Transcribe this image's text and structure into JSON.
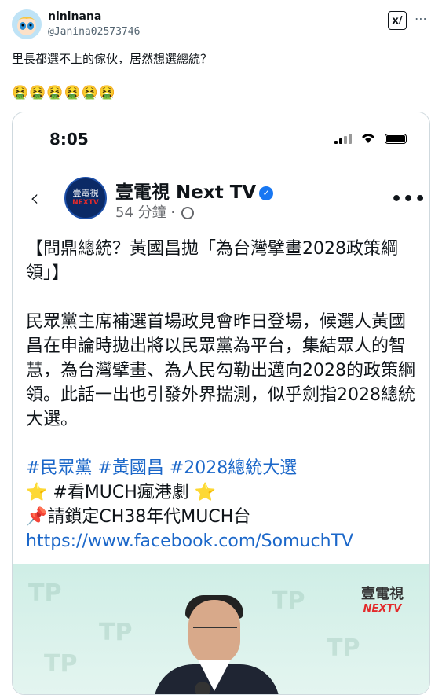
{
  "tweet": {
    "display_name": "nininana",
    "handle": "@Janina02573746",
    "text": "里長都選不上的傢伙，居然想選總統？",
    "emojis": "🤮🤮🤮🤮🤮🤮",
    "grok_label": "x/",
    "more_label": "⋯"
  },
  "screenshot": {
    "status_time": "8:05",
    "page_name": "壹電視 Next TV",
    "verified_mark": "✓",
    "post_time": "54 分鐘 ·",
    "avatar_cn": "壹電視",
    "avatar_en": "NEXTV",
    "back_glyph": "‹",
    "more_glyph": "•••",
    "title_line": "【問鼎總統？黃國昌拋「為台灣擘畫2028政策綱領」】",
    "paragraph": "民眾黨主席補選首場政見會昨日登場，候選人黃國昌在申論時拋出將以民眾黨為平台，集結眾人的智慧，為台灣擘畫、為人民勾勒出邁向2028的政策綱領。此話一出也引發外界揣測，似乎劍指2028總統大選。",
    "hashtags": "#民眾黨 #黃國昌 #2028總統大選",
    "much_line": "⭐ #看MUCH瘋港劇 ⭐",
    "channel_line": "📌請鎖定CH38年代MUCH台",
    "url": "https://www.facebook.com/SomuchTV",
    "photo_logo_cn": "壹電視",
    "photo_logo_en": "NEXTV"
  }
}
